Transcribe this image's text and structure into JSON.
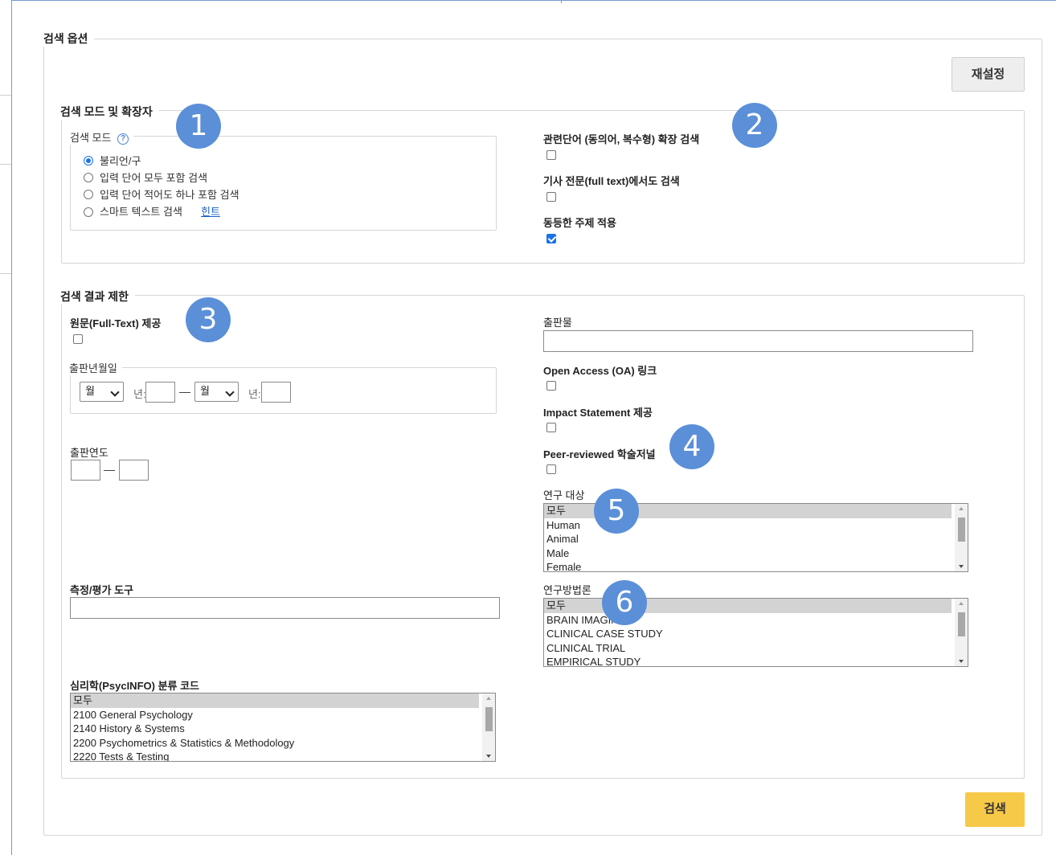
{
  "options": {
    "title": "검색 옵션",
    "reset_label": "재설정",
    "search_label": "검색"
  },
  "mode_section": {
    "title": "검색 모드 및 확장자",
    "search_mode": {
      "title": "검색 모드",
      "help": "?",
      "radios": [
        {
          "label": "불리언/구",
          "checked": true
        },
        {
          "label": "입력 단어 모두 포함 검색",
          "checked": false
        },
        {
          "label": "입력 단어 적어도 하나 포함 검색",
          "checked": false
        },
        {
          "label": "스마트 텍스트 검색",
          "checked": false
        }
      ],
      "hint_link": "힌트"
    },
    "expanders": [
      {
        "label": "관련단어 (동의어, 복수형) 확장 검색",
        "checked": false
      },
      {
        "label": "기사 전문(full text)에서도 검색",
        "checked": false
      },
      {
        "label": "동등한 주제 적용",
        "checked": true
      }
    ]
  },
  "limit_section": {
    "title": "검색 결과 제한",
    "full_text": {
      "label": "원문(Full-Text) 제공",
      "checked": false
    },
    "pub_date": {
      "title": "출판년월일",
      "month_from": "월",
      "year_label_from": "년:",
      "year_from": "",
      "month_to": "월",
      "year_label_to": "년:",
      "year_to": "",
      "dash": "—"
    },
    "pub_year": {
      "label": "출판연도",
      "from": "",
      "to": "",
      "dash": "—"
    },
    "measure": {
      "label": "측정/평가 도구",
      "value": ""
    },
    "classification": {
      "label": "심리학(PsycINFO) 분류 코드",
      "options": [
        "모두",
        "2100 General Psychology",
        "2140 History & Systems",
        "2200 Psychometrics & Statistics & Methodology",
        "2220 Tests & Testing"
      ],
      "selected": 0
    },
    "publication": {
      "label": "출판물",
      "value": ""
    },
    "open_access": {
      "label": "Open Access (OA) 링크",
      "checked": false
    },
    "impact": {
      "label": "Impact Statement 제공",
      "checked": false
    },
    "peer": {
      "label": "Peer-reviewed 학술저널",
      "checked": false
    },
    "population": {
      "label": "연구 대상",
      "options": [
        "모두",
        "Human",
        "Animal",
        "Male",
        "Female"
      ],
      "selected": 0
    },
    "methodology": {
      "label": "연구방법론",
      "options": [
        "모두",
        "BRAIN IMAGING",
        "CLINICAL CASE STUDY",
        "CLINICAL TRIAL",
        "EMPIRICAL STUDY"
      ],
      "selected": 0
    }
  },
  "badges": [
    "1",
    "2",
    "3",
    "4",
    "5",
    "6"
  ],
  "colors": {
    "accent": "#1a73e8",
    "badge": "#5b8fd8",
    "search_button": "#f7c948"
  }
}
